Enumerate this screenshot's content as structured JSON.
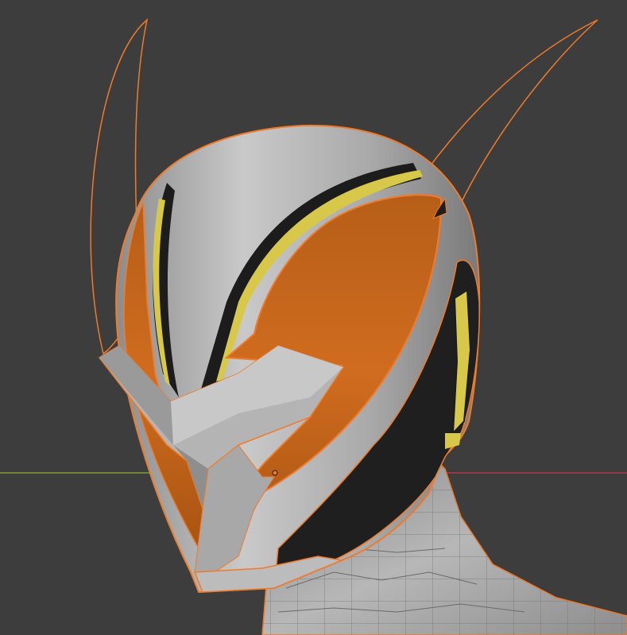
{
  "viewport": {
    "background": "#3d3d3d",
    "selection_outline_color": "#f07a2a",
    "x_axis_color": "#b0384a",
    "y_axis_color": "#7fa23a",
    "origin_marker": "object-origin-point"
  },
  "scene": {
    "object": "helmet",
    "material_base": "#a9a9a9",
    "material_visor": "#c8681a",
    "material_trim_dark": "#1e1e1e",
    "material_trim_accent": "#d7c84a",
    "body_mesh": "#9c9c9c",
    "selection_state": "selected"
  }
}
